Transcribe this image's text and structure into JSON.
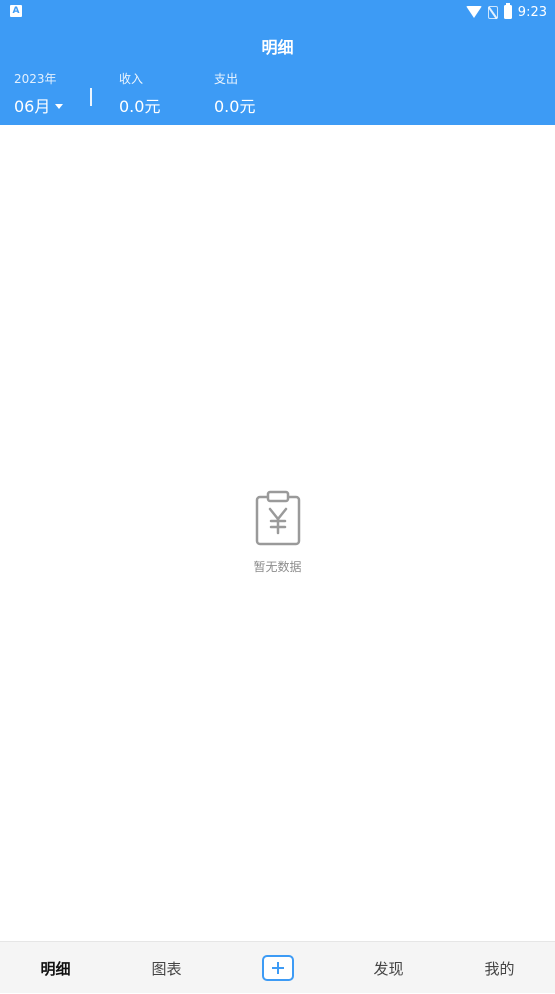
{
  "status_bar": {
    "app_icon_letter": "A",
    "time": "9:23",
    "icons": [
      "wifi-icon",
      "no-sim-icon",
      "battery-icon"
    ]
  },
  "header": {
    "title": "明细",
    "year": "2023年",
    "month": "06月",
    "income_label": "收入",
    "income_value": "0.0元",
    "expense_label": "支出",
    "expense_value": "0.0元",
    "accent_color": "#3d9bf5"
  },
  "empty_state": {
    "icon": "clipboard-yen-icon",
    "text": "暂无数据"
  },
  "tabbar": {
    "tabs": [
      {
        "label": "明细",
        "active": true
      },
      {
        "label": "图表",
        "active": false
      },
      {
        "label": "",
        "icon": "add-icon",
        "active": false
      },
      {
        "label": "发现",
        "active": false
      },
      {
        "label": "我的",
        "active": false
      }
    ]
  }
}
